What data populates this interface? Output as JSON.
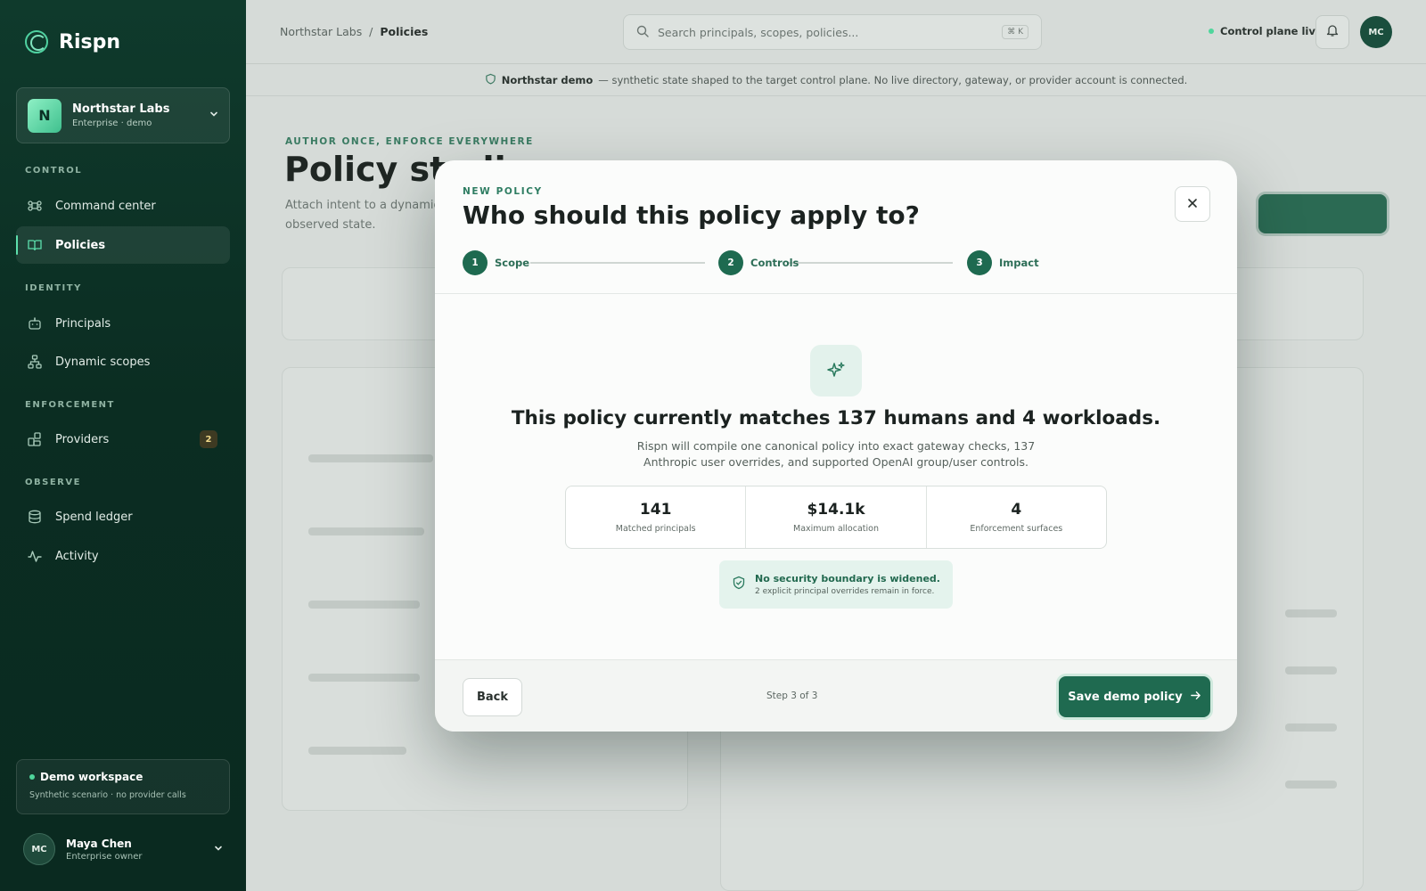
{
  "app": {
    "name": "Rispn"
  },
  "org": {
    "avatar": "N",
    "name": "Northstar Labs",
    "sub": "Enterprise · demo"
  },
  "nav": {
    "sections": [
      "CONTROL",
      "IDENTITY",
      "ENFORCEMENT",
      "OBSERVE"
    ],
    "items": [
      {
        "label": "Command center",
        "icon": "command-icon"
      },
      {
        "label": "Policies",
        "icon": "book-icon",
        "active": true
      },
      {
        "label": "Principals",
        "icon": "robot-icon"
      },
      {
        "label": "Dynamic scopes",
        "icon": "hierarchy-icon"
      },
      {
        "label": "Providers",
        "icon": "blocks-icon",
        "badge": "2"
      },
      {
        "label": "Spend ledger",
        "icon": "database-icon"
      },
      {
        "label": "Activity",
        "icon": "pulse-icon"
      }
    ]
  },
  "demo": {
    "title": "Demo workspace",
    "sub": "Synthetic scenario · no provider calls"
  },
  "user": {
    "initials": "MC",
    "name": "Maya Chen",
    "role": "Enterprise owner"
  },
  "topbar": {
    "crumb_root": "Northstar Labs",
    "crumb_sep": "/",
    "crumb_current": "Policies",
    "search_placeholder": "Search principals, scopes, policies...",
    "search_kbd": "⌘ K",
    "status": "Control plane live",
    "avatar": "MC"
  },
  "banner": {
    "bold": "Northstar demo",
    "text": "— synthetic state shaped to the target control plane. No live directory, gateway, or provider account is connected."
  },
  "page": {
    "eyebrow": "AUTHOR ONCE, ENFORCE EVERYWHERE",
    "title": "Policy studi",
    "desc": "Attach intent to a dynamic observed state."
  },
  "modal": {
    "eyebrow": "NEW POLICY",
    "title": "Who should this policy apply to?",
    "steps": [
      {
        "num": "1",
        "label": "Scope"
      },
      {
        "num": "2",
        "label": "Controls"
      },
      {
        "num": "3",
        "label": "Impact"
      }
    ],
    "headline": "This policy currently matches 137 humans and 4 workloads.",
    "explain": "Rispn will compile one canonical policy into exact gateway checks, 137 Anthropic user overrides, and supported OpenAI group/user controls.",
    "stats": [
      {
        "value": "141",
        "label": "Matched principals"
      },
      {
        "value": "$14.1k",
        "label": "Maximum allocation"
      },
      {
        "value": "4",
        "label": "Enforcement surfaces"
      }
    ],
    "notice_title": "No security boundary is widened.",
    "notice_sub": "2 explicit principal overrides remain in force.",
    "back_label": "Back",
    "step_count": "Step 3 of 3",
    "save_label": "Save demo policy"
  },
  "colors": {
    "accent": "#1f6a50",
    "sidebar": "#0b2d22",
    "badge": "#f0d98a"
  }
}
